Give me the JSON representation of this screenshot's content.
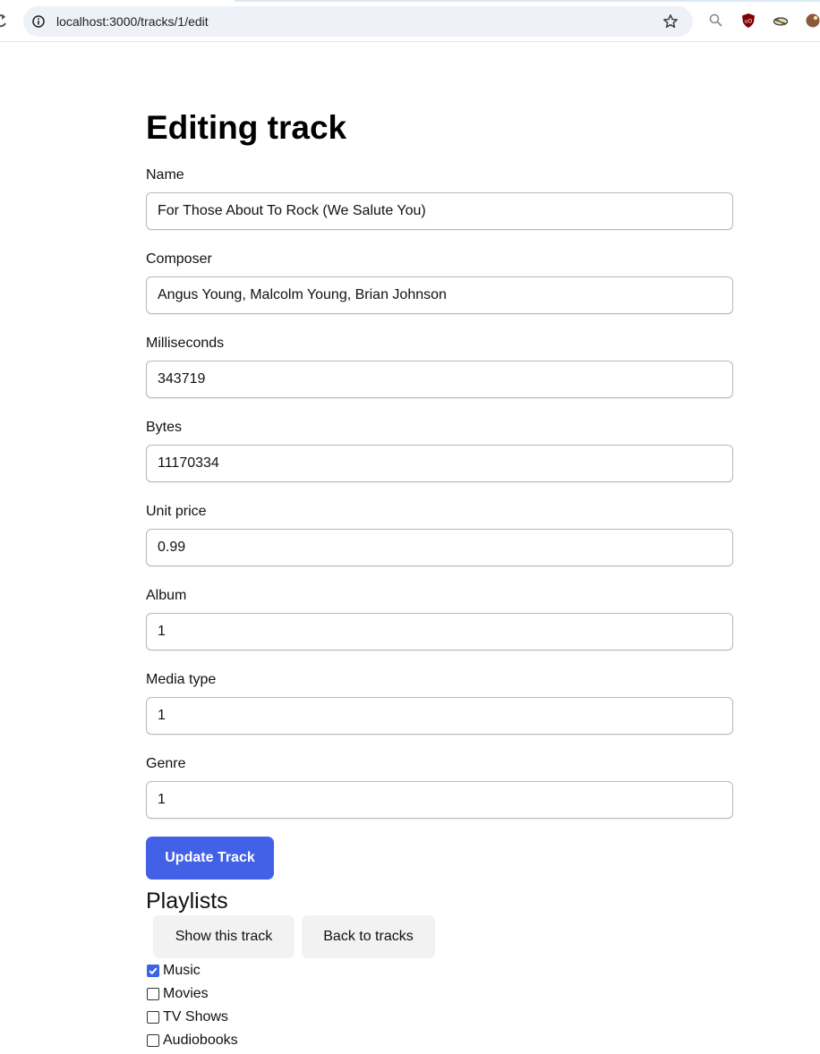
{
  "browser": {
    "url": "localhost:3000/tracks/1/edit"
  },
  "page": {
    "title": "Editing track"
  },
  "form": {
    "fields": [
      {
        "label": "Name",
        "value": "For Those About To Rock (We Salute You)"
      },
      {
        "label": "Composer",
        "value": "Angus Young, Malcolm Young, Brian Johnson"
      },
      {
        "label": "Milliseconds",
        "value": "343719"
      },
      {
        "label": "Bytes",
        "value": "11170334"
      },
      {
        "label": "Unit price",
        "value": "0.99"
      },
      {
        "label": "Album",
        "value": "1"
      },
      {
        "label": "Media type",
        "value": "1"
      },
      {
        "label": "Genre",
        "value": "1"
      }
    ],
    "submit_label": "Update Track"
  },
  "playlists": {
    "heading": "Playlists",
    "items": [
      {
        "label": "Music",
        "checked": true
      },
      {
        "label": "Movies",
        "checked": false
      },
      {
        "label": "TV Shows",
        "checked": false
      },
      {
        "label": "Audiobooks",
        "checked": false
      }
    ]
  },
  "actions": {
    "show_label": "Show this track",
    "back_label": "Back to tracks"
  },
  "colors": {
    "primary": "#4261e6",
    "secondary_button": "#f2f2f3",
    "checkbox_checked": "#3b63e6"
  }
}
